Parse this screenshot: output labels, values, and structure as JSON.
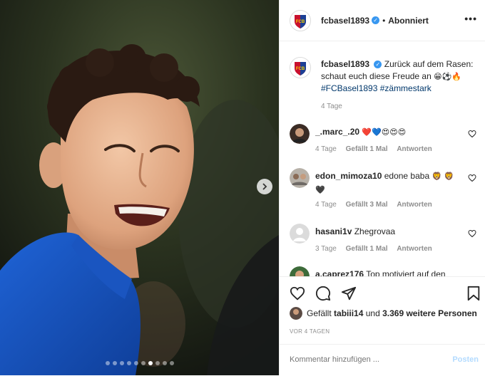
{
  "header": {
    "username": "fcbasel1893",
    "separator": "•",
    "follow_status": "Abonniert",
    "more_label": "•••"
  },
  "caption": {
    "username": "fcbasel1893",
    "text": "Zurück auf dem Rasen: schaut euch diese Freude an",
    "emoji": "😁⚽🔥",
    "hashtags": "#FCBasel1893 #zämmestark",
    "time": "4 Tage"
  },
  "comments": [
    {
      "username": "_.marc_.20",
      "text": "",
      "emoji": "❤️💙😍😍😍",
      "time": "4 Tage",
      "likes": "Gefällt 1 Mal",
      "reply": "Antworten"
    },
    {
      "username": "edon_mimoza10",
      "text": "edone baba",
      "emoji": "🦁 🦁🖤",
      "time": "4 Tage",
      "likes": "Gefällt 3 Mal",
      "reply": "Antworten"
    },
    {
      "username": "hasani1v",
      "text": "Zhegrovaa",
      "emoji": "",
      "time": "3 Tage",
      "likes": "Gefällt 1 Mal",
      "reply": "Antworten"
    },
    {
      "username": "a.caprez176",
      "text": "Top motiviert auf den",
      "emoji": "",
      "time": "",
      "likes": "",
      "reply": ""
    }
  ],
  "likes": {
    "prefix": "Gefällt",
    "user": "tabiii14",
    "middle": "und",
    "count": "3.369 weitere Personen"
  },
  "posted": "VOR 4 TAGEN",
  "composer": {
    "placeholder": "Kommentar hinzufügen ...",
    "post_label": "Posten"
  },
  "carousel": {
    "total": 10,
    "active_index": 6
  },
  "icons": {
    "like": "heart-icon",
    "comment": "comment-bubble-icon",
    "share": "paper-plane-icon",
    "save": "bookmark-icon",
    "next": "chevron-right-icon",
    "verified": "verified-badge-icon"
  },
  "colors": {
    "link": "#00376b",
    "verified": "#3897f0",
    "muted": "#8e8e8e",
    "post_disabled": "#b3dbff",
    "heart_red": "#ed4956"
  }
}
